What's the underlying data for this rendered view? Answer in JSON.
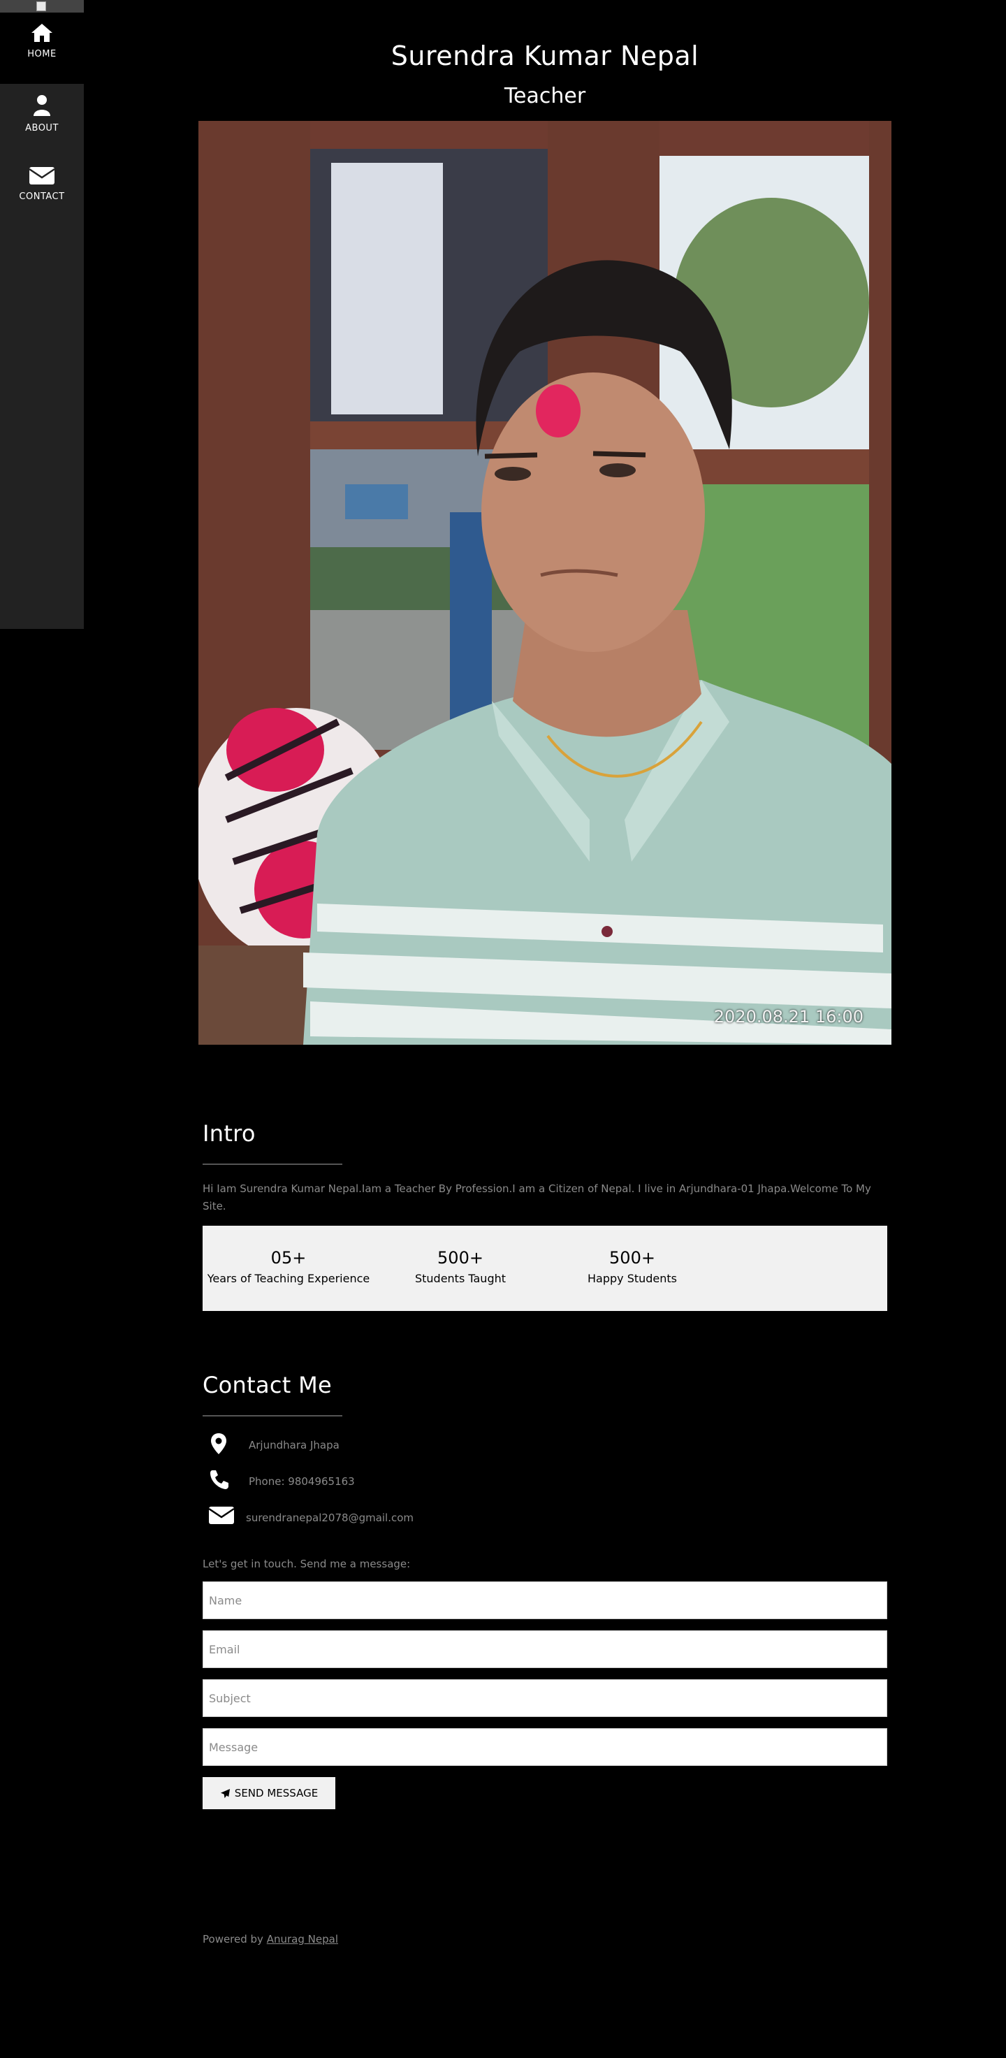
{
  "nav": {
    "items": [
      {
        "label": "HOME",
        "icon": "home-icon",
        "active": true
      },
      {
        "label": "ABOUT",
        "icon": "user-icon",
        "active": false
      },
      {
        "label": "CONTACT",
        "icon": "envelope-icon",
        "active": false
      }
    ]
  },
  "header": {
    "name": "Surendra Kumar Nepal",
    "role": "Teacher"
  },
  "photo": {
    "timestamp": "2020.08.21 16:00"
  },
  "intro": {
    "title": "Intro",
    "text": "Hi Iam Surendra Kumar Nepal.Iam a Teacher By Profession.I am a Citizen of Nepal. I live in Arjundhara-01 Jhapa.Welcome To My Site.",
    "stats": [
      {
        "number": "05+",
        "label": "Years of Teaching Experience"
      },
      {
        "number": "500+",
        "label": "Students Taught"
      },
      {
        "number": "500+",
        "label": "Happy Students"
      }
    ]
  },
  "contact": {
    "title": "Contact Me",
    "location": "Arjundhara Jhapa",
    "phone": "Phone: 9804965163",
    "email": "surendranepal2078@gmail.com",
    "cta": "Let's get in touch. Send me a message:",
    "form": {
      "name_placeholder": "Name",
      "email_placeholder": "Email",
      "subject_placeholder": "Subject",
      "message_placeholder": "Message",
      "send_label": "SEND MESSAGE"
    }
  },
  "footer": {
    "prefix": "Powered by",
    "link_text": "Anurag Nepal"
  },
  "colors": {
    "background": "#000000",
    "sidebar": "#222222",
    "muted_text": "#8a8a8a",
    "stats_bg": "#f1f1f1"
  }
}
